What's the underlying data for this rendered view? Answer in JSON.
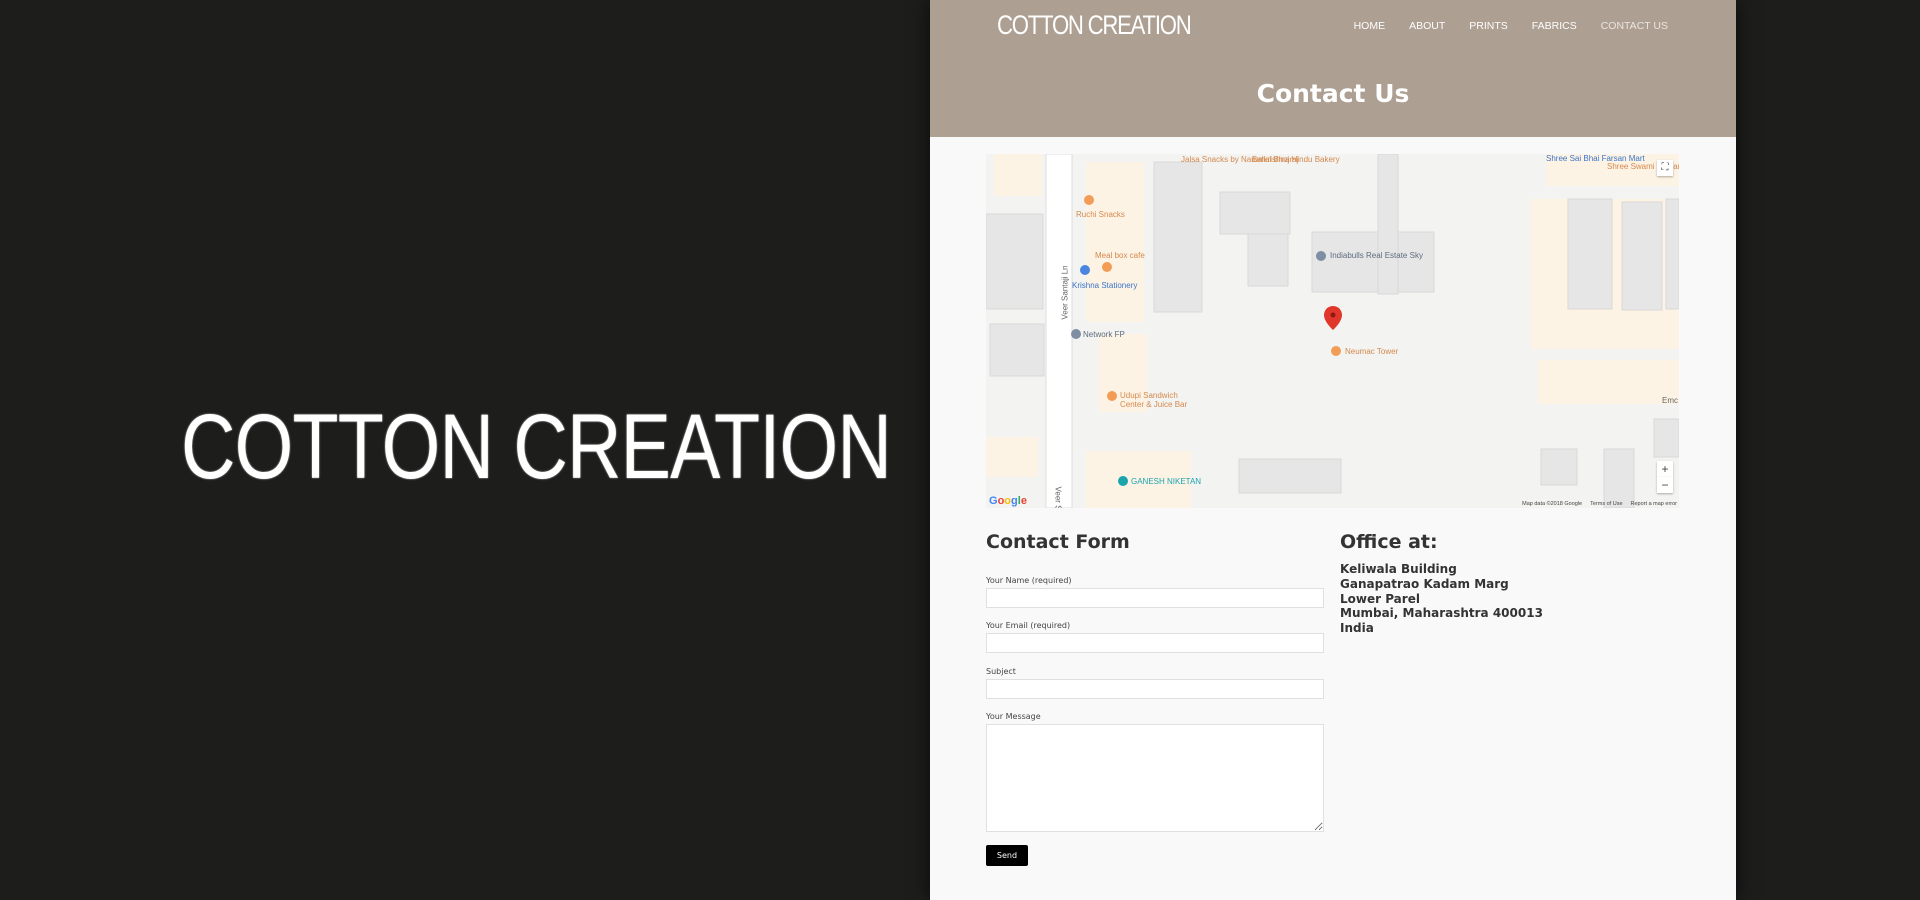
{
  "brand": {
    "big_logo": "COTTON CREATION",
    "logo": "COTTON CREATION"
  },
  "nav": {
    "items": [
      "HOME",
      "ABOUT",
      "PRINTS",
      "FABRICS",
      "CONTACT US"
    ]
  },
  "page_title": "Contact Us",
  "map": {
    "labels": {
      "jalsa": "Jalsa Snacks by Narumal Bhojraj",
      "balkrishna": "Balkrishna Hindu Bakery",
      "shree_sai": "Shree Sai Bhai Farsan Mart",
      "shree_swami": "Shree Swami Samarth Snacks",
      "ruchi": "Ruchi Snacks",
      "meal_box": "Meal box cafe",
      "krishna": "Krishna Stationery",
      "indiabulls": "Indiabulls Real Estate Sky",
      "network": "Network FP",
      "neumac": "Neumac Tower",
      "udupi": "Udupi Sandwich Center & Juice Bar",
      "ganesh": "GANESH NIKETAN",
      "emc": "Emc",
      "road1": "Veer Santaji Ln",
      "road2": "Veer S"
    },
    "footer": {
      "data": "Map data ©2018 Google",
      "terms": "Terms of Use",
      "report": "Report a map error"
    },
    "zoom_in": "+",
    "zoom_out": "−"
  },
  "contact_form": {
    "title": "Contact Form",
    "name_label": "Your Name (required)",
    "email_label": "Your Email (required)",
    "subject_label": "Subject",
    "message_label": "Your Message",
    "send_label": "Send"
  },
  "office": {
    "title": "Office at:",
    "lines": [
      "Keliwala Building",
      "Ganapatrao Kadam Marg",
      "Lower Parel",
      "Mumbai, Maharashtra 400013",
      "India"
    ]
  },
  "colors": {
    "header_bg": "#ad9f92",
    "dark_bg": "#1d1d1c",
    "button_bg": "#000000"
  }
}
